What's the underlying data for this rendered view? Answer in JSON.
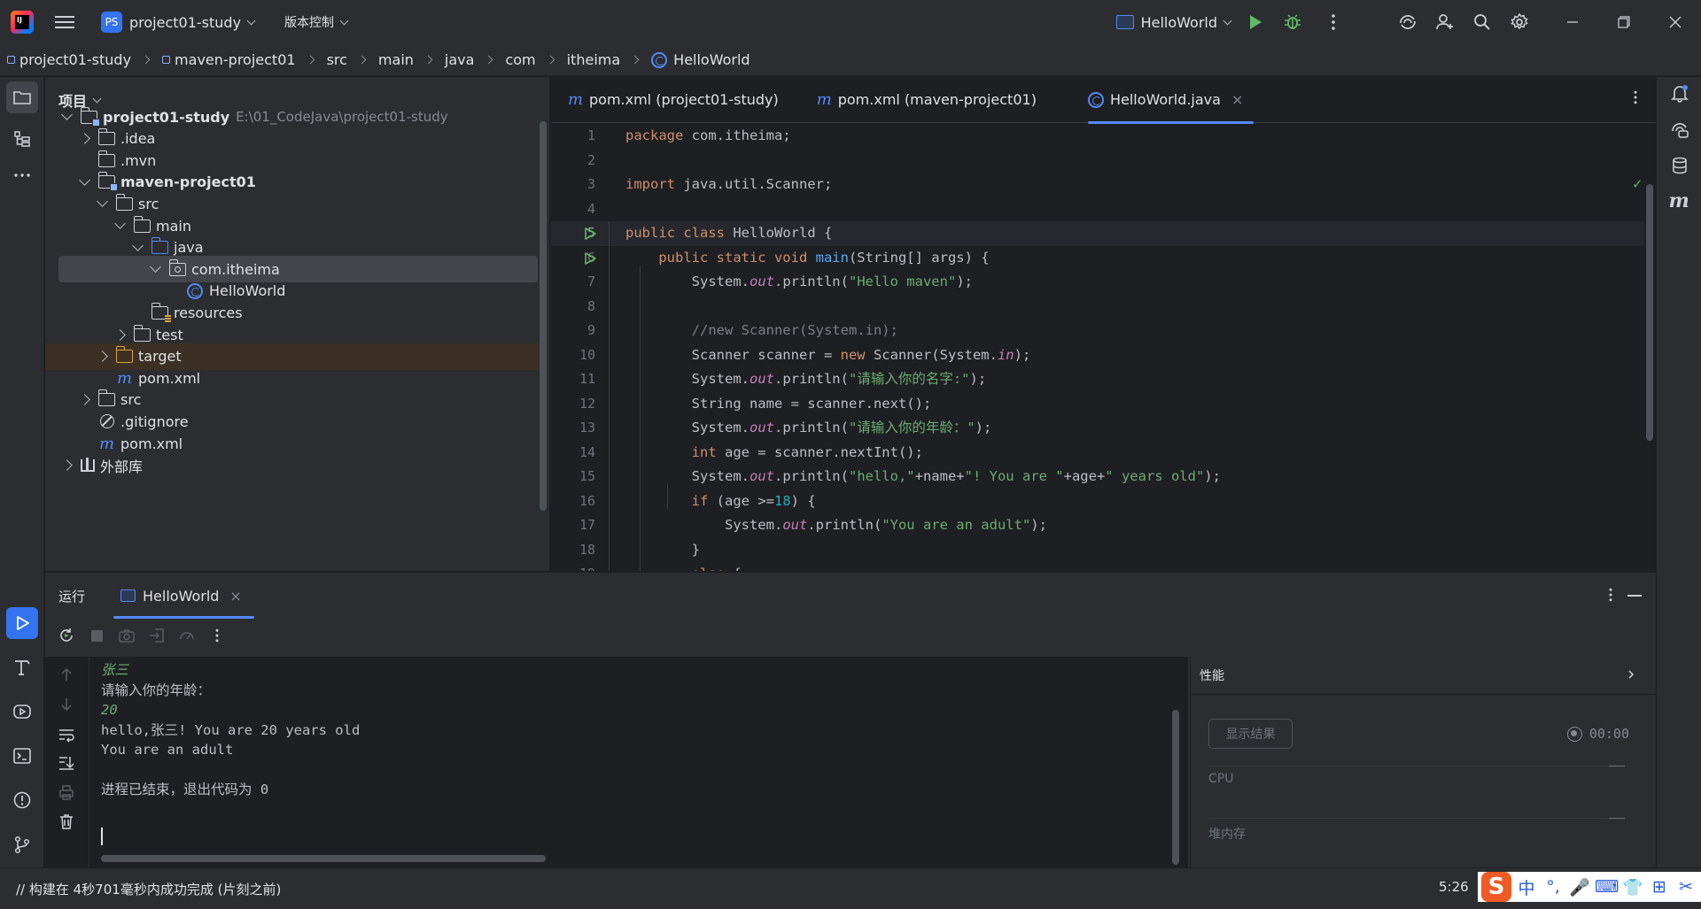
{
  "window": {
    "project_badge": "PS",
    "project_name": "project01-study",
    "vcs_label": "版本控制",
    "run_config": "HelloWorld",
    "colors": {
      "accent": "#548af7",
      "run_green": "#5fb865",
      "bg": "#1e1f22",
      "panel": "#2b2d30"
    }
  },
  "breadcrumb": [
    "project01-study",
    "maven-project01",
    "src",
    "main",
    "java",
    "com",
    "itheima",
    "HelloWorld"
  ],
  "project_panel": {
    "title": "项目",
    "root_path": "E:\\01_CodeJava\\project01-study",
    "tree": [
      {
        "label": "project01-study",
        "depth": 0,
        "arrow": "down",
        "icon": "module-folder-icon",
        "bold": true
      },
      {
        "label": ".idea",
        "depth": 1,
        "arrow": "right",
        "icon": "folder-icon"
      },
      {
        "label": ".mvn",
        "depth": 1,
        "arrow": "none",
        "icon": "folder-icon"
      },
      {
        "label": "maven-project01",
        "depth": 1,
        "arrow": "down",
        "icon": "module-folder-icon",
        "bold": true
      },
      {
        "label": "src",
        "depth": 2,
        "arrow": "down",
        "icon": "folder-icon"
      },
      {
        "label": "main",
        "depth": 3,
        "arrow": "down",
        "icon": "folder-icon"
      },
      {
        "label": "java",
        "depth": 4,
        "arrow": "down",
        "icon": "source-folder-icon"
      },
      {
        "label": "com.itheima",
        "depth": 5,
        "arrow": "down",
        "icon": "package-icon",
        "selected": true
      },
      {
        "label": "HelloWorld",
        "depth": 6,
        "arrow": "none",
        "icon": "class-icon"
      },
      {
        "label": "resources",
        "depth": 4,
        "arrow": "none",
        "icon": "resources-folder-icon"
      },
      {
        "label": "test",
        "depth": 3,
        "arrow": "right",
        "icon": "folder-icon"
      },
      {
        "label": "target",
        "depth": 2,
        "arrow": "right",
        "icon": "excluded-folder-icon",
        "highlight": true
      },
      {
        "label": "pom.xml",
        "depth": 2,
        "arrow": "none",
        "icon": "maven-icon"
      },
      {
        "label": "src",
        "depth": 1,
        "arrow": "right",
        "icon": "folder-icon"
      },
      {
        "label": ".gitignore",
        "depth": 1,
        "arrow": "none",
        "icon": "ignore-file-icon"
      },
      {
        "label": "pom.xml",
        "depth": 1,
        "arrow": "none",
        "icon": "maven-icon"
      },
      {
        "label": "外部库",
        "depth": 0,
        "arrow": "right",
        "icon": "library-icon"
      }
    ]
  },
  "editor": {
    "tabs": [
      {
        "label": "pom.xml (project01-study)",
        "icon": "maven-icon",
        "active": false
      },
      {
        "label": "pom.xml (maven-project01)",
        "icon": "maven-icon",
        "active": false
      },
      {
        "label": "HelloWorld.java",
        "icon": "class-icon",
        "active": true
      }
    ],
    "current_line": 5,
    "run_gutter_lines": [
      5,
      6
    ],
    "code": [
      [
        [
          "kw",
          "package "
        ],
        [
          "",
          "com.itheima;"
        ]
      ],
      [],
      [
        [
          "kw",
          "import "
        ],
        [
          "",
          "java.util.Scanner;"
        ]
      ],
      [],
      [
        [
          "kw",
          "public class "
        ],
        [
          "",
          "HelloWorld {"
        ]
      ],
      [
        [
          "",
          "    "
        ],
        [
          "kw",
          "public static void "
        ],
        [
          "fn",
          "main"
        ],
        [
          "",
          "(String[] args) {"
        ]
      ],
      [
        [
          "",
          "        System."
        ],
        [
          "fld",
          "out"
        ],
        [
          "",
          ".println("
        ],
        [
          "str",
          "\"Hello maven\""
        ],
        [
          "",
          ");"
        ]
      ],
      [],
      [
        [
          "",
          "        "
        ],
        [
          "cmt",
          "//new Scanner(System.in);"
        ]
      ],
      [
        [
          "",
          "        Scanner scanner = "
        ],
        [
          "kw",
          "new "
        ],
        [
          "",
          "Scanner(System."
        ],
        [
          "fld",
          "in"
        ],
        [
          "",
          ");"
        ]
      ],
      [
        [
          "",
          "        System."
        ],
        [
          "fld",
          "out"
        ],
        [
          "",
          ".println("
        ],
        [
          "str",
          "\"请输入你的名字:\""
        ],
        [
          "",
          ");"
        ]
      ],
      [
        [
          "",
          "        String name = scanner.next();"
        ]
      ],
      [
        [
          "",
          "        System."
        ],
        [
          "fld",
          "out"
        ],
        [
          "",
          ".println("
        ],
        [
          "str",
          "\"请输入你的年龄：\""
        ],
        [
          "",
          ");"
        ]
      ],
      [
        [
          "",
          "        "
        ],
        [
          "kw",
          "int "
        ],
        [
          "",
          "age = scanner.nextInt();"
        ]
      ],
      [
        [
          "",
          "        System."
        ],
        [
          "fld",
          "out"
        ],
        [
          "",
          ".println("
        ],
        [
          "str",
          "\"hello,\""
        ],
        [
          "",
          "+name+"
        ],
        [
          "str",
          "\"! You are \""
        ],
        [
          "",
          "+age+"
        ],
        [
          "str",
          "\" years old\""
        ],
        [
          "",
          ");"
        ]
      ],
      [
        [
          "",
          "        "
        ],
        [
          "kw",
          "if "
        ],
        [
          "",
          "(age >="
        ],
        [
          "num",
          "18"
        ],
        [
          "",
          ") {"
        ]
      ],
      [
        [
          "",
          "            System."
        ],
        [
          "fld",
          "out"
        ],
        [
          "",
          ".println("
        ],
        [
          "str",
          "\"You are an adult\""
        ],
        [
          "",
          ");"
        ]
      ],
      [
        [
          "",
          "        }"
        ]
      ],
      [
        [
          "",
          "        "
        ],
        [
          "kw",
          "else "
        ],
        [
          "",
          "{"
        ]
      ]
    ]
  },
  "run_panel": {
    "title": "运行",
    "tab_label": "HelloWorld",
    "console": [
      {
        "text": "张三",
        "input": true
      },
      {
        "text": "请输入你的年龄：",
        "input": false
      },
      {
        "text": "20",
        "input": true
      },
      {
        "text": "hello,张三! You are 20 years old",
        "input": false
      },
      {
        "text": "You are an adult",
        "input": false
      },
      {
        "text": "",
        "input": false
      },
      {
        "text": "进程已结束，退出代码为 0",
        "input": false
      }
    ],
    "perf": {
      "title": "性能",
      "show_results": "显示结果",
      "timer": "00:00",
      "cpu_label": "CPU",
      "heap_label": "堆内存"
    }
  },
  "status_bar": {
    "message": "// 构建在 4秒701毫秒内成功完成 (片刻之前)",
    "position": "5:26",
    "ime_logo": "S",
    "ime_items": [
      "中",
      "°,",
      "🎤",
      "⌨",
      "👕",
      "⊞",
      "✂"
    ]
  }
}
